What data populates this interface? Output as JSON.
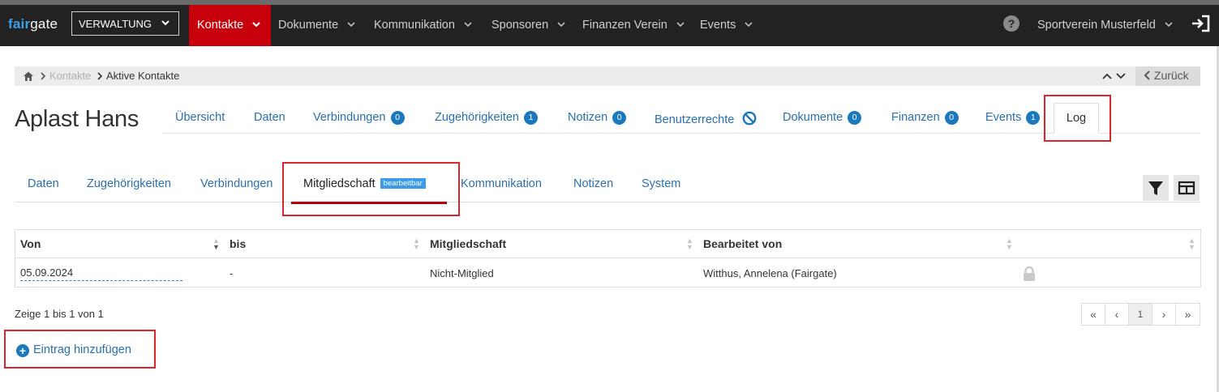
{
  "app": {
    "logo_part1": "fair",
    "logo_part2": "gate",
    "org_selector": "VERWALTUNG",
    "club": "Sportverein Musterfeld",
    "help_icon": "question-circle-icon",
    "logout_icon": "sign-out-icon",
    "help_glyph": "?"
  },
  "nav": {
    "items": [
      {
        "label": "Kontakte",
        "active": true
      },
      {
        "label": "Dokumente"
      },
      {
        "label": "Kommunikation"
      },
      {
        "label": "Sponsoren"
      },
      {
        "label": "Finanzen Verein"
      },
      {
        "label": "Events"
      }
    ],
    "active_color": "#c8000b"
  },
  "breadcrumb": {
    "items": [
      "Kontakte",
      "Aktive Kontakte"
    ],
    "back_label": "Zurück",
    "home_icon": "home-icon"
  },
  "contact": {
    "name": "Aplast Hans"
  },
  "main_tabs": [
    {
      "label": "Übersicht"
    },
    {
      "label": "Daten"
    },
    {
      "label": "Verbindungen",
      "badge": "0"
    },
    {
      "label": "Zugehörigkeiten",
      "badge": "1"
    },
    {
      "label": "Notizen",
      "badge": "0"
    },
    {
      "label": "Benutzerrechte",
      "icon": "ban-icon"
    },
    {
      "label": "Dokumente",
      "badge": "0"
    },
    {
      "label": "Finanzen",
      "badge": "0"
    },
    {
      "label": "Events",
      "badge": "1"
    },
    {
      "label": "Log",
      "active": true
    }
  ],
  "log_tabs": [
    {
      "label": "Daten"
    },
    {
      "label": "Zugehörigkeiten"
    },
    {
      "label": "Verbindungen"
    },
    {
      "label": "Mitgliedschaft",
      "tag": "bearbeitbar",
      "active": true
    },
    {
      "label": "Kommunikation"
    },
    {
      "label": "Notizen"
    },
    {
      "label": "System"
    }
  ],
  "toolbar": {
    "filter_icon": "filter-icon",
    "columns_icon": "table-columns-icon"
  },
  "table": {
    "columns": [
      "Von",
      "bis",
      "Mitgliedschaft",
      "Bearbeitet von",
      ""
    ],
    "rows": [
      {
        "von": "05.09.2024",
        "bis": "-",
        "mitgliedschaft": "Nicht-Mitglied",
        "bearbeitet_von": "Witthus, Annelena (Fairgate)",
        "locked_icon": "lock-icon"
      }
    ]
  },
  "info_text": "Zeige 1 bis 1 von 1",
  "pagination": {
    "first": "«",
    "prev": "‹",
    "current": "1",
    "next": "›",
    "last": "»"
  },
  "add_entry": {
    "label": "Eintrag hinzufügen",
    "plus": "+"
  },
  "colors": {
    "link": "#2a6fb0",
    "badge": "#1a79bd",
    "tag": "#3b9bea",
    "highlight": "#d9262c",
    "navbar": "#222222"
  }
}
